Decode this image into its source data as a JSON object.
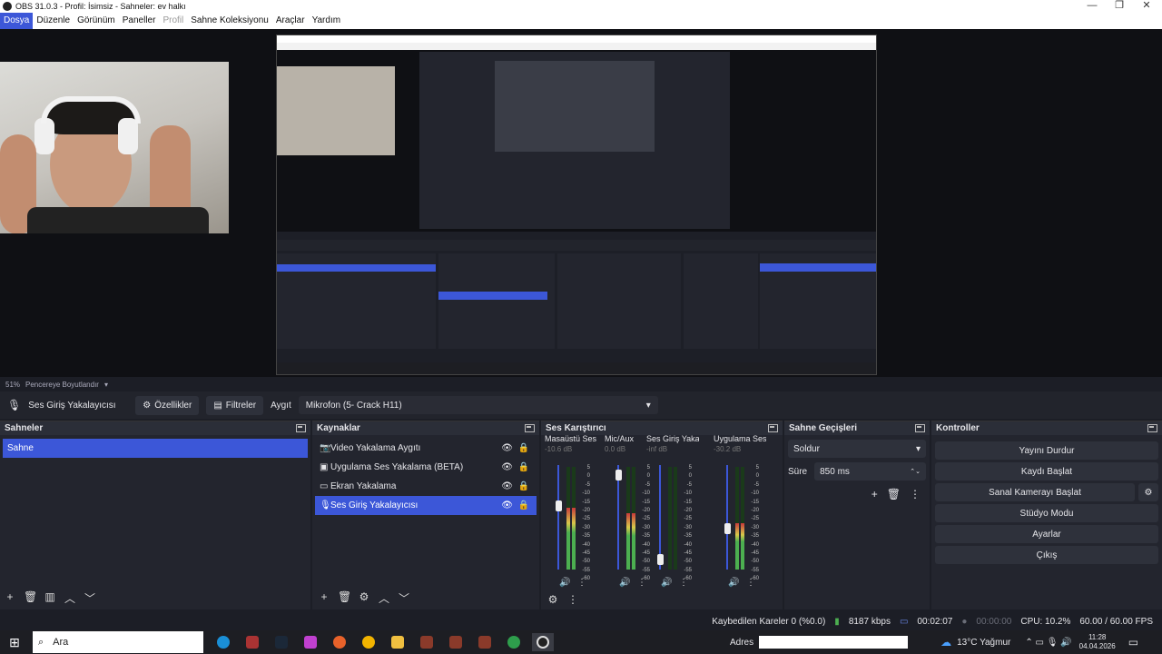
{
  "titlebar": {
    "title": "OBS 31.0.3 - Profil: İsimsiz - Sahneler: ev halkı",
    "min": "—",
    "max": "❐",
    "close": "✕"
  },
  "menu": [
    "Dosya",
    "Düzenle",
    "Görünüm",
    "Paneller",
    "Profil",
    "Sahne Koleksiyonu",
    "Araçlar",
    "Yardım"
  ],
  "zoom": {
    "percent": "51%",
    "mode": "Pencereye Boyutlandır"
  },
  "sourcebar": {
    "name": "Ses Giriş Yakalayıcısı",
    "props": "Özellikler",
    "filters": "Filtreler",
    "device_label": "Aygıt",
    "device_value": "Mikrofon (5- Crack H11)"
  },
  "scenes": {
    "title": "Sahneler",
    "items": [
      "Sahne"
    ]
  },
  "sources": {
    "title": "Kaynaklar",
    "items": [
      "Video Yakalama Aygıtı",
      "Uygulama Ses Yakalama (BETA)",
      "Ekran Yakalama",
      "Ses Giriş Yakalayıcısı"
    ]
  },
  "mixer": {
    "title": "Ses Karıştırıcı",
    "channels": [
      {
        "name": "Masaüstü Ses",
        "db": "-10.6 dB",
        "level": 0.6,
        "fader": 0.62
      },
      {
        "name": "Mic/Aux",
        "db": "0.0 dB",
        "level": 0.55,
        "fader": 0.95
      },
      {
        "name": "Ses Giriş Yakalay",
        "db": "-inf dB",
        "level": 0.0,
        "fader": 0.05
      },
      {
        "name": "Uygulama Ses Ya",
        "db": "-30.2 dB",
        "level": 0.45,
        "fader": 0.38
      }
    ],
    "scale": [
      "5",
      "0",
      "-5",
      "-10",
      "-15",
      "-20",
      "-25",
      "-30",
      "-35",
      "-40",
      "-45",
      "-50",
      "-55",
      "-60"
    ]
  },
  "transitions": {
    "title": "Sahne Geçişleri",
    "type": "Soldur",
    "duration_label": "Süre",
    "duration_value": "850 ms"
  },
  "controls": {
    "title": "Kontroller",
    "buttons": [
      "Yayını Durdur",
      "Kaydı Başlat",
      "Sanal Kamerayı Başlat",
      "Stüdyo Modu",
      "Ayarlar",
      "Çıkış"
    ]
  },
  "status": {
    "dropped": "Kaybedilen Kareler 0 (%0.0)",
    "bitrate": "8187 kbps",
    "stream_time": "00:02:07",
    "rec_time": "00:00:00",
    "cpu": "CPU: 10.2%",
    "fps": "60.00 / 60.00 FPS"
  },
  "taskbar": {
    "search": "Ara",
    "address_label": "Adres",
    "weather": "13°C  Yağmur",
    "time": "11:28",
    "date": "04.04.2026"
  }
}
